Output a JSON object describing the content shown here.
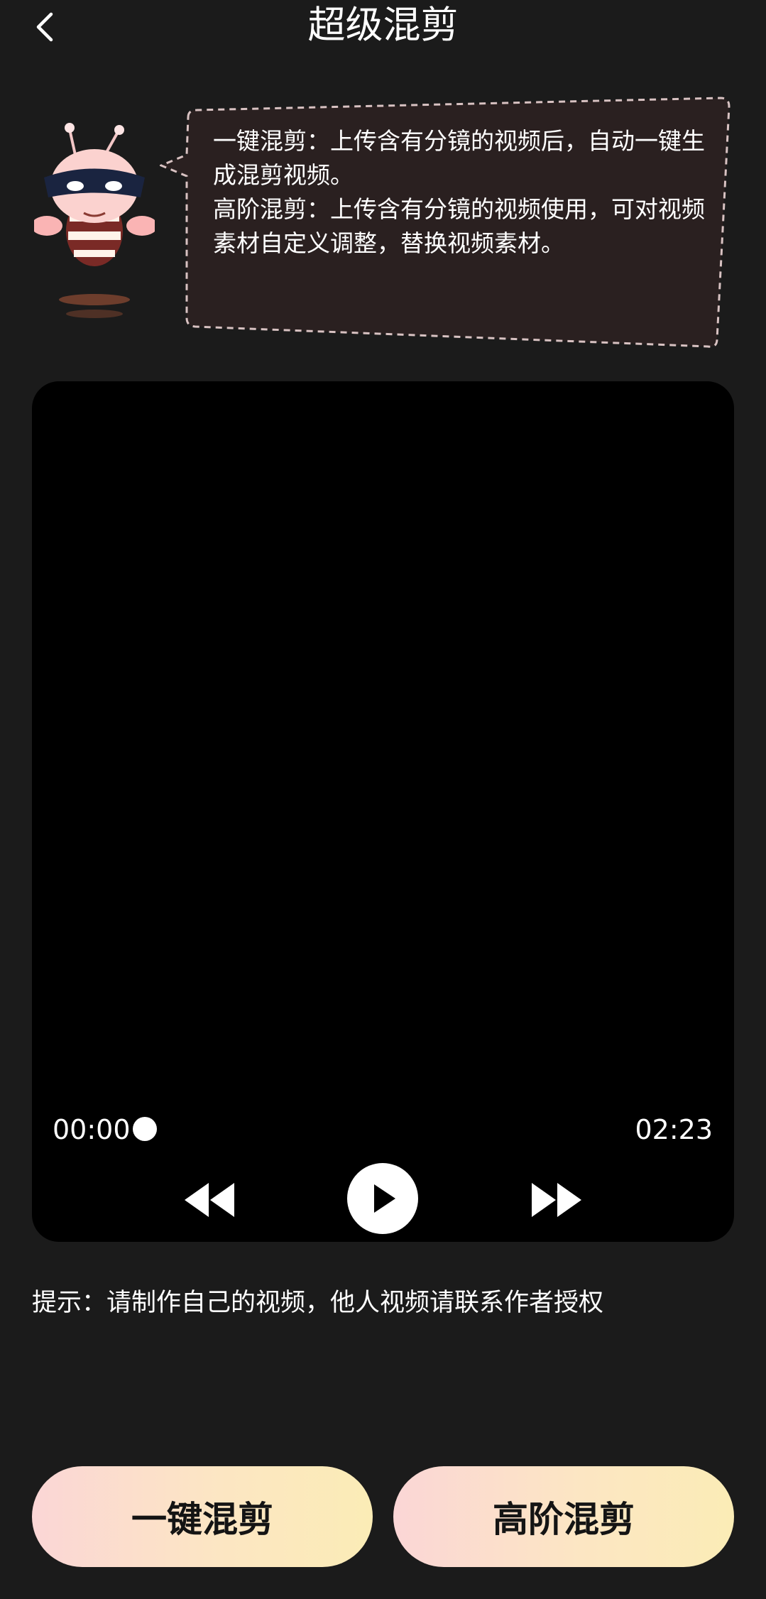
{
  "header": {
    "title": "超级混剪",
    "back_icon": "chevron-left-icon"
  },
  "bubble": {
    "line1": "一键混剪：上传含有分镜的视频后，自动一键生成混剪视频。",
    "line2": "高阶混剪：上传含有分镜的视频使用，可对视频素材自定义调整，替换视频素材。"
  },
  "player": {
    "current_time": "00:00",
    "total_time": "02:23",
    "progress": 0,
    "icons": [
      "rewind-icon",
      "play-icon",
      "fast-forward-icon"
    ]
  },
  "tip": "提示：请制作自己的视频，他人视频请联系作者授权",
  "actions": {
    "one_click_label": "一键混剪",
    "advanced_label": "高阶混剪"
  },
  "colors": {
    "background": "#1b1b1b",
    "bubble_fill": "#2a2020",
    "button_gradient_start": "#fbd6d6",
    "button_gradient_end": "#fbecb6"
  }
}
